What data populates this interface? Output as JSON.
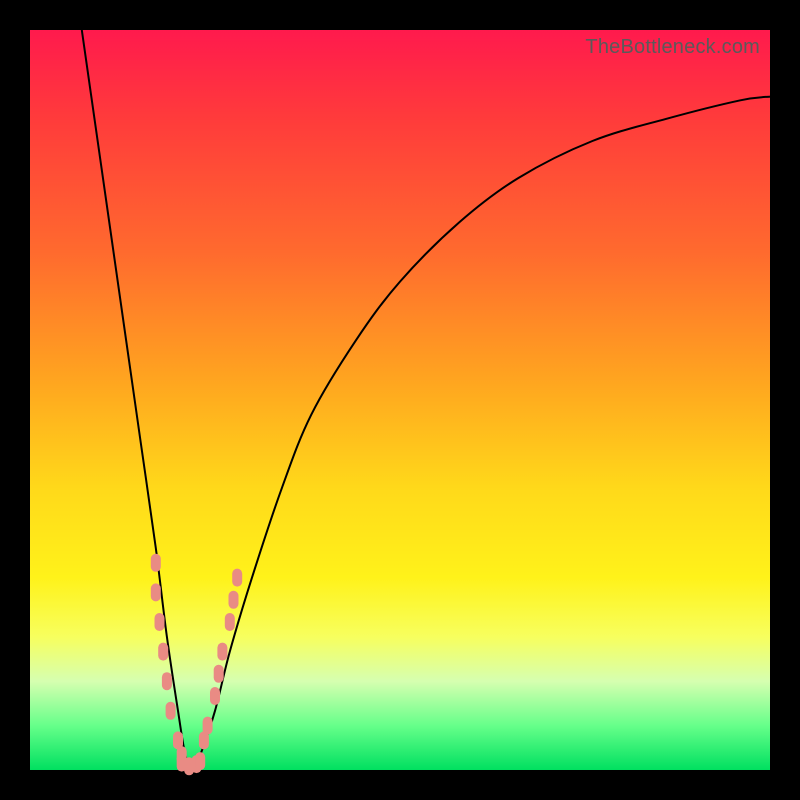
{
  "watermark": "TheBottleneck.com",
  "chart_data": {
    "type": "line",
    "title": "",
    "xlabel": "",
    "ylabel": "",
    "xlim": [
      0,
      100
    ],
    "ylim": [
      0,
      100
    ],
    "series": [
      {
        "name": "bottleneck-curve",
        "x": [
          7,
          9,
          11,
          13,
          15,
          17,
          18.5,
          20,
          21,
          22,
          23,
          25,
          27,
          30,
          34,
          38,
          44,
          50,
          58,
          66,
          76,
          86,
          96,
          100
        ],
        "values": [
          100,
          86,
          72,
          58,
          44,
          30,
          18,
          8,
          2,
          0,
          2,
          8,
          16,
          26,
          38,
          48,
          58,
          66,
          74,
          80,
          85,
          88,
          90.5,
          91
        ]
      }
    ],
    "markers": [
      {
        "name": "left-cluster",
        "points_xy": [
          [
            17,
            28
          ],
          [
            17,
            24
          ],
          [
            17.5,
            20
          ],
          [
            18,
            16
          ],
          [
            18.5,
            12
          ],
          [
            19,
            8
          ],
          [
            20,
            4
          ],
          [
            20.5,
            2
          ]
        ]
      },
      {
        "name": "right-cluster",
        "points_xy": [
          [
            23.5,
            4
          ],
          [
            24,
            6
          ],
          [
            25,
            10
          ],
          [
            25.5,
            13
          ],
          [
            26,
            16
          ],
          [
            27,
            20
          ],
          [
            27.5,
            23
          ],
          [
            28,
            26
          ]
        ]
      },
      {
        "name": "bottom-cluster",
        "points_xy": [
          [
            20.5,
            1
          ],
          [
            21.5,
            0.5
          ],
          [
            22.5,
            0.8
          ],
          [
            23,
            1.2
          ]
        ]
      }
    ],
    "marker_color": "#e98b84",
    "curve_color": "#000000"
  }
}
